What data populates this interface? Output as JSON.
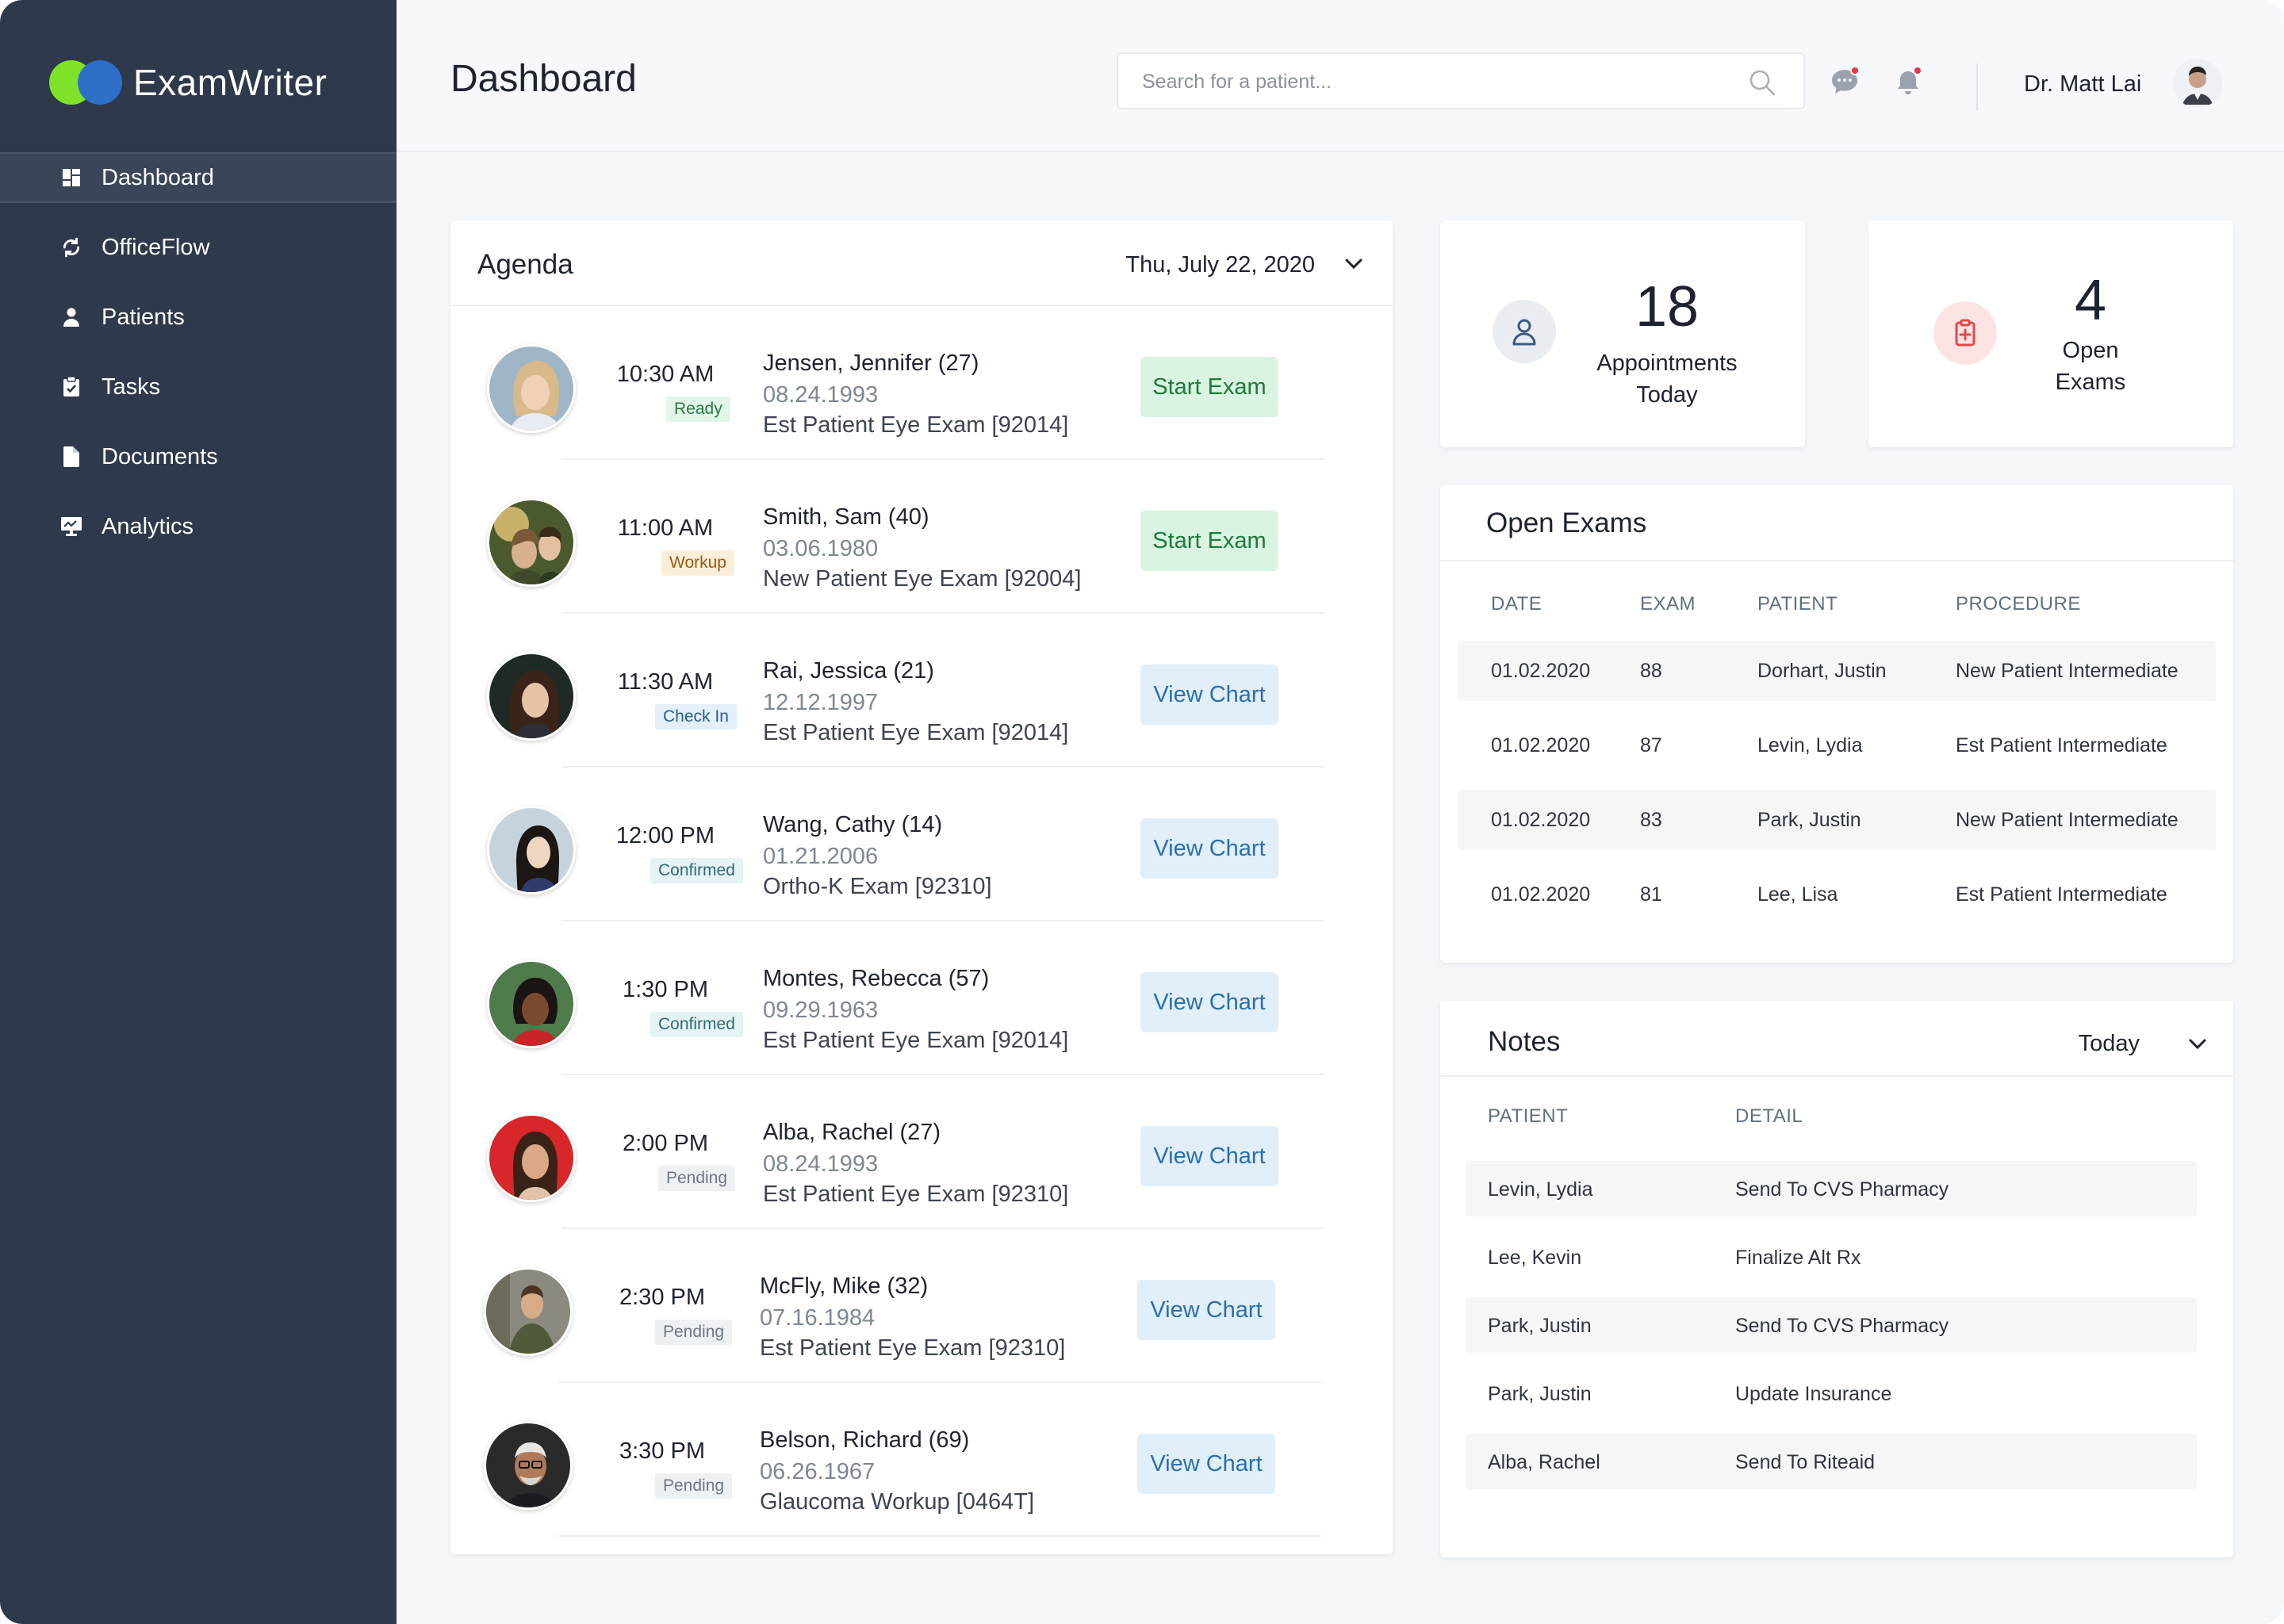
{
  "app": {
    "name": "ExamWriter"
  },
  "sidebar": {
    "items": [
      {
        "label": "Dashboard",
        "icon": "dashboard-icon",
        "active": true
      },
      {
        "label": "OfficeFlow",
        "icon": "refresh-icon"
      },
      {
        "label": "Patients",
        "icon": "person-icon"
      },
      {
        "label": "Tasks",
        "icon": "clipboard-check-icon"
      },
      {
        "label": "Documents",
        "icon": "document-icon"
      },
      {
        "label": "Analytics",
        "icon": "analytics-icon"
      }
    ]
  },
  "header": {
    "title": "Dashboard",
    "search_placeholder": "Search for a patient...",
    "user_name": "Dr. Matt Lai"
  },
  "agenda": {
    "title": "Agenda",
    "date": "Thu, July 22, 2020",
    "appointments": [
      {
        "time": "10:30 AM",
        "status": "Ready",
        "name": "Jensen, Jennifer (27)",
        "dob": "08.24.1993",
        "procedure": "Est Patient Eye Exam [92014]",
        "action": "Start Exam"
      },
      {
        "time": "11:00 AM",
        "status": "Workup",
        "name": "Smith, Sam (40)",
        "dob": "03.06.1980",
        "procedure": "New Patient Eye Exam [92004]",
        "action": "Start Exam"
      },
      {
        "time": "11:30 AM",
        "status": "Check In",
        "name": "Rai, Jessica (21)",
        "dob": "12.12.1997",
        "procedure": "Est Patient Eye Exam [92014]",
        "action": "View Chart"
      },
      {
        "time": "12:00 PM",
        "status": "Confirmed",
        "name": "Wang, Cathy (14)",
        "dob": "01.21.2006",
        "procedure": "Ortho-K Exam [92310]",
        "action": "View Chart"
      },
      {
        "time": "1:30 PM",
        "status": "Confirmed",
        "name": "Montes, Rebecca (57)",
        "dob": "09.29.1963",
        "procedure": "Est Patient Eye Exam [92014]",
        "action": "View Chart"
      },
      {
        "time": "2:00 PM",
        "status": "Pending",
        "name": "Alba, Rachel (27)",
        "dob": "08.24.1993",
        "procedure": "Est Patient Eye Exam [92310]",
        "action": "View Chart"
      },
      {
        "time": "2:30 PM",
        "status": "Pending",
        "name": "McFly, Mike (32)",
        "dob": "07.16.1984",
        "procedure": "Est Patient Eye Exam [92310]",
        "action": "View Chart"
      },
      {
        "time": "3:30 PM",
        "status": "Pending",
        "name": "Belson, Richard (69)",
        "dob": "06.26.1967",
        "procedure": "Glaucoma Workup [0464T]",
        "action": "View Chart"
      }
    ]
  },
  "stats": {
    "appointments": {
      "value": "18",
      "label_line1": "Appointments",
      "label_line2": "Today"
    },
    "open_exams": {
      "value": "4",
      "label_line1": "Open",
      "label_line2": "Exams"
    }
  },
  "open_exams": {
    "title": "Open Exams",
    "columns": [
      "DATE",
      "EXAM",
      "PATIENT",
      "PROCEDURE"
    ],
    "rows": [
      [
        "01.02.2020",
        "88",
        "Dorhart, Justin",
        "New Patient Intermediate"
      ],
      [
        "01.02.2020",
        "87",
        "Levin, Lydia",
        "Est Patient Intermediate"
      ],
      [
        "01.02.2020",
        "83",
        "Park, Justin",
        "New Patient Intermediate"
      ],
      [
        "01.02.2020",
        "81",
        "Lee, Lisa",
        "Est Patient Intermediate"
      ]
    ]
  },
  "notes": {
    "title": "Notes",
    "filter": "Today",
    "columns": [
      "PATIENT",
      "DETAIL"
    ],
    "rows": [
      [
        "Levin, Lydia",
        "Send To CVS Pharmacy"
      ],
      [
        "Lee, Kevin",
        "Finalize Alt Rx"
      ],
      [
        "Park, Justin",
        "Send To CVS Pharmacy"
      ],
      [
        "Park, Justin",
        "Update Insurance"
      ],
      [
        "Alba, Rachel",
        "Send To Riteaid"
      ]
    ]
  },
  "colors": {
    "sidebar": "#2f394c",
    "accent_green": "#7fe32a",
    "accent_blue": "#2e6fc8",
    "notification_dot": "#e53945"
  }
}
